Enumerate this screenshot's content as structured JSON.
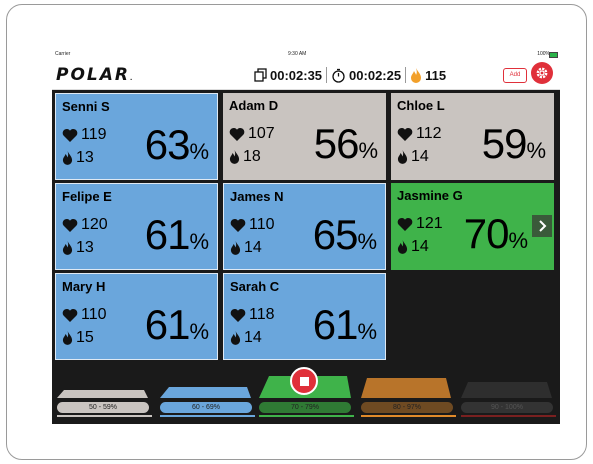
{
  "status_bar": {
    "carrier": "Carrier",
    "time": "9:30 AM",
    "battery": "100%"
  },
  "brand": {
    "logo_text": "POLAR",
    "trademark": "."
  },
  "header": {
    "session_time": "00:02:35",
    "timer": "00:02:25",
    "calories_total": "115",
    "add_label": "Add"
  },
  "colors": {
    "zone_50_59": "#c9c4c0",
    "zone_60_69": "#6aa6dc",
    "zone_70_79": "#3fb34a",
    "zone_80_89": "#e08a2a",
    "zone_90_100": "#dd3030",
    "accent_red": "#e0303a"
  },
  "participants": [
    {
      "name": "Senni S",
      "heart_rate": "119",
      "calories": "13",
      "percent": "63",
      "unit": "%",
      "zone": "60-69"
    },
    {
      "name": "Adam D",
      "heart_rate": "107",
      "calories": "18",
      "percent": "56",
      "unit": "%",
      "zone": "50-59"
    },
    {
      "name": "Chloe L",
      "heart_rate": "112",
      "calories": "14",
      "percent": "59",
      "unit": "%",
      "zone": "50-59"
    },
    {
      "name": "Felipe E",
      "heart_rate": "120",
      "calories": "13",
      "percent": "61",
      "unit": "%",
      "zone": "60-69"
    },
    {
      "name": "James N",
      "heart_rate": "110",
      "calories": "14",
      "percent": "65",
      "unit": "%",
      "zone": "60-69"
    },
    {
      "name": "Jasmine G",
      "heart_rate": "121",
      "calories": "14",
      "percent": "70",
      "unit": "%",
      "zone": "70-79"
    },
    {
      "name": "Mary H",
      "heart_rate": "110",
      "calories": "15",
      "percent": "61",
      "unit": "%",
      "zone": "60-69"
    },
    {
      "name": "Sarah C",
      "heart_rate": "118",
      "calories": "14",
      "percent": "61",
      "unit": "%",
      "zone": "60-69"
    }
  ],
  "zones": [
    {
      "label": "50 - 59%"
    },
    {
      "label": "60 - 69%"
    },
    {
      "label": "70 - 79%"
    },
    {
      "label": "80 - 97%"
    },
    {
      "label": "90 - 100%"
    }
  ],
  "icons": {
    "heart": "heart-icon",
    "flame": "flame-icon",
    "stopwatch": "stopwatch-icon",
    "copy": "copy-icon",
    "gear": "gear-icon",
    "chevron": "chevron-right-icon",
    "stop": "stop-icon"
  }
}
